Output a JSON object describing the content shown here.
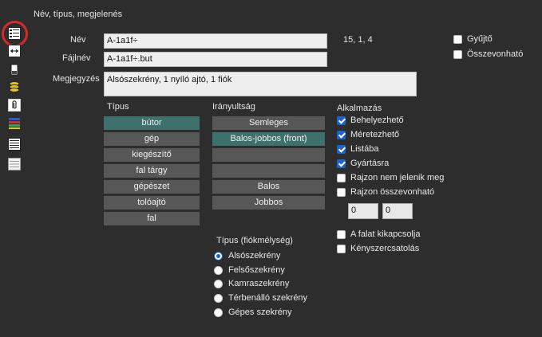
{
  "section_title": "Név, típus, megjelenés",
  "toolbar": {
    "items": [
      {
        "icon": "name-type-icon"
      },
      {
        "icon": "resize-arrows-icon"
      },
      {
        "icon": "battery-icon"
      },
      {
        "icon": "database-layers-icon"
      },
      {
        "icon": "paperclip-icon"
      },
      {
        "icon": "color-bars-icon"
      },
      {
        "icon": "lines-list-icon"
      },
      {
        "icon": "lines-list-light-icon"
      }
    ]
  },
  "fields": {
    "nev_label": "Név",
    "nev_value": "A-1a1f÷",
    "coords": "15, 1, 4",
    "fajlnev_label": "Fájlnév",
    "fajlnev_value": "A-1a1f÷.but",
    "megjegyzes_label": "Megjegyzés",
    "megjegyzes_value": "Alsószekrény, 1 nyíló ajtó, 1 fiók"
  },
  "top_checks": [
    {
      "label": "Gyűjtő",
      "checked": false
    },
    {
      "label": "Összevonható",
      "checked": false
    }
  ],
  "tipus": {
    "title": "Típus",
    "items": [
      "bútor",
      "gép",
      "kiegészítő",
      "fal tárgy",
      "gépészet",
      "tolóajtó",
      "fal"
    ],
    "selected": 0
  },
  "iranyultsag": {
    "title": "Irányultság",
    "items": [
      "Semleges",
      "Balos-jobbos (front)",
      "",
      "",
      "Balos",
      "Jobbos"
    ],
    "selected": 1
  },
  "alkalmazas": {
    "title": "Alkalmazás",
    "items": [
      {
        "label": "Behelyezhető",
        "checked": true
      },
      {
        "label": "Méretezhető",
        "checked": true
      },
      {
        "label": "Listába",
        "checked": true
      },
      {
        "label": "Gyártásra",
        "checked": true
      },
      {
        "label": "Rajzon nem jelenik meg",
        "checked": false
      },
      {
        "label": "Rajzon összevonható",
        "checked": false
      }
    ],
    "num1": "0",
    "num2": "0",
    "extra": [
      {
        "label": "A falat kikapcsolja",
        "checked": false
      },
      {
        "label": "Kényszercsatolás",
        "checked": false
      }
    ]
  },
  "fiokmelyseg": {
    "title": "Típus (fiókmélység)",
    "items": [
      "Alsószekrény",
      "Felsőszekrény",
      "Kamraszekrény",
      "Térbenálló szekrény",
      "Gépes szekrény"
    ],
    "selected": 0
  }
}
